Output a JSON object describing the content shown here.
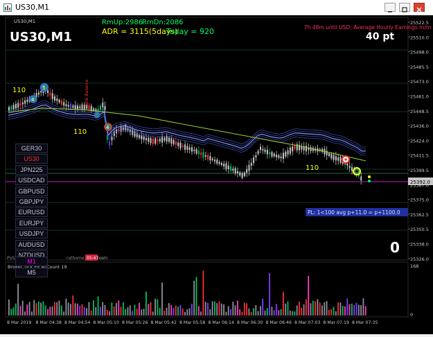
{
  "window": {
    "title": "US30,M1",
    "brand_color": "#d9412f"
  },
  "chart": {
    "symbol_tf": "US30,M1",
    "inner_label": "US30,M1",
    "rmup": "RmUp:2986",
    "rmdn": "RmDn:2086",
    "adr": "ADR = 3115(5days)",
    "today": "Today = 920",
    "news": "7h 48m until USD: Average Hourly Earnings m/m",
    "points": "40 pt",
    "big_zero": "0",
    "pl_text": "PL: 1<100 avg p+11.0 = p+1100.0",
    "rotated_label": "Tank Balance",
    "markers": [
      "110",
      "110",
      "110"
    ],
    "marker_numbers": [
      "5",
      "4",
      "4"
    ],
    "footer_left": "PVS",
    "footer_mid": "rathome @ donnal",
    "footer_badge": "05:47",
    "footer_right": "com",
    "price_axis": [
      "25522.5",
      "25510.0",
      "25498.0",
      "25485.5",
      "25473.0",
      "25461.0",
      "25448.5",
      "25436.0",
      "25424.0",
      "25411.5",
      "25399.5",
      "25387.0",
      "25375.0",
      "25362.5",
      "25350.5",
      "25338.0",
      "25326.0"
    ],
    "current_price": "25392.0",
    "colors": {
      "background": "#000000",
      "grid": "#0f3a2a",
      "bull": "#c8c8c8",
      "ma_slow": "#9acd32",
      "band": "#5060c0",
      "accent_green": "#00ff66",
      "accent_yellow": "#ffff00",
      "accent_red": "#ff3030",
      "price_line": "#c020c0"
    }
  },
  "symbols": [
    "GER30",
    "US30",
    "JPN225",
    "USDCAD",
    "GBPUSD",
    "GBPJPY",
    "EURUSD",
    "EURJPY",
    "USDJPY",
    "AUDUSD",
    "NZDUSD"
  ],
  "symbols_active": "US30",
  "timeframes": [
    "M1",
    "M5"
  ],
  "timeframes_active": "M1",
  "indicator": {
    "name": "Broker Tick PV Ai",
    "count": "Count 19",
    "scale_top": "168",
    "scale_bottom": "0"
  },
  "time_axis": [
    "8 Mar 2019",
    "8 Mar 04:38",
    "8 Mar 04:54",
    "8 Mar 05:10",
    "8 Mar 05:26",
    "8 Mar 05:42",
    "8 Mar 05:58",
    "8 Mar 06:14",
    "8 Mar 06:30",
    "8 Mar 06:46",
    "8 Mar 07:03",
    "8 Mar 07:19",
    "8 Mar 07:35"
  ]
}
